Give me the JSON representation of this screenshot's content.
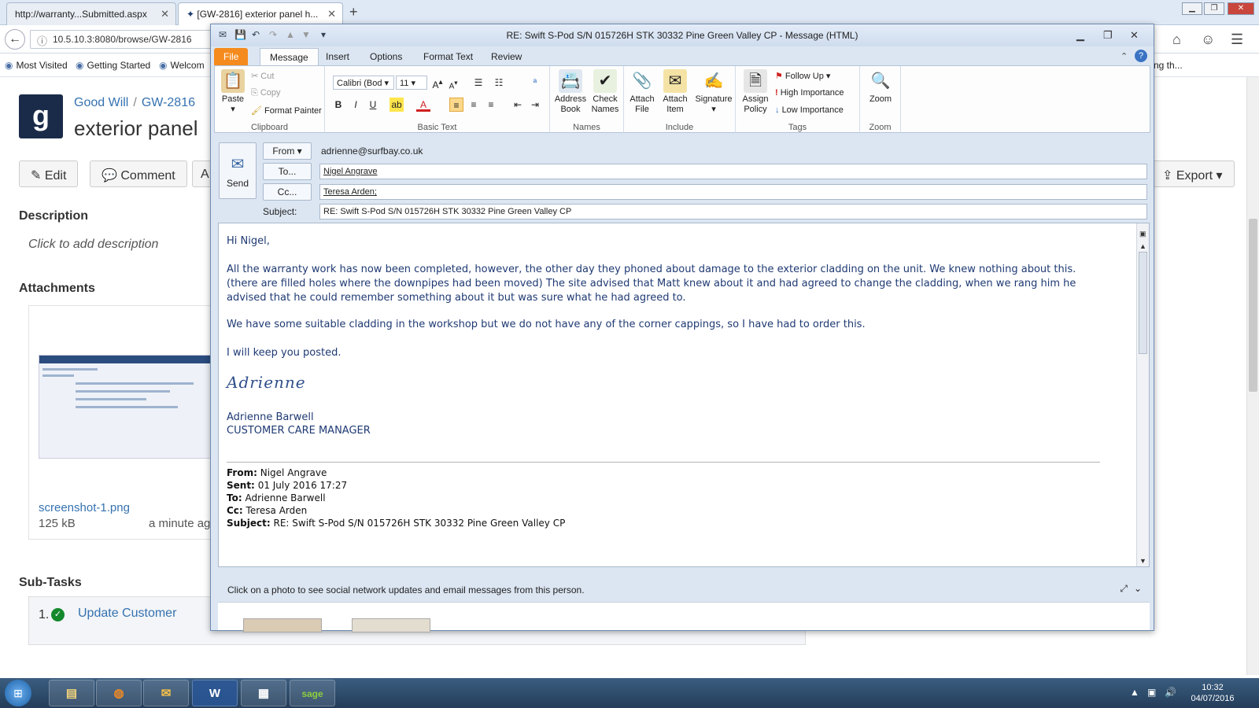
{
  "browser": {
    "tabs": [
      {
        "label": "http://warranty...Submitted.aspx"
      },
      {
        "label": "[GW-2816] exterior panel h..."
      }
    ],
    "url": "10.5.10.3:8080/browse/GW-2816",
    "bookmarks": [
      "Most Visited",
      "Getting Started",
      "Welcom"
    ],
    "bookmark_right_fragment": "ng th..."
  },
  "jira": {
    "logo_text": "g",
    "breadcrumb": {
      "project": "Good Will",
      "issue_key": "GW-2816"
    },
    "title": "exterior panel",
    "buttons": {
      "edit": "Edit",
      "comment": "Comment",
      "more": "A",
      "export": "Export"
    },
    "description": {
      "heading": "Description",
      "placeholder": "Click to add description"
    },
    "attachments": {
      "heading": "Attachments",
      "file_name": "screenshot-1.png",
      "file_size": "125 kB",
      "time": "a minute ag"
    },
    "subtasks": {
      "heading": "Sub-Tasks",
      "number": "1.",
      "item": "Update Customer"
    }
  },
  "outlook": {
    "title": "RE: Swift S-Pod S/N 015726H STK 30332 Pine Green Valley CP  -  Message (HTML)",
    "tabs": [
      "File",
      "Message",
      "Insert",
      "Options",
      "Format Text",
      "Review"
    ],
    "ribbon": {
      "clipboard": {
        "label": "Clipboard",
        "paste": "Paste",
        "cut": "Cut",
        "copy": "Copy",
        "format_painter": "Format Painter"
      },
      "basic_text": {
        "label": "Basic Text",
        "font": "Calibri (Bod",
        "size": "11"
      },
      "names": {
        "label": "Names",
        "address_book": "Address Book",
        "check_names": "Check Names"
      },
      "include": {
        "label": "Include",
        "attach_file": "Attach File",
        "attach_item": "Attach Item",
        "signature": "Signature"
      },
      "tags": {
        "label": "Tags",
        "assign_policy": "Assign Policy",
        "follow_up": "Follow Up",
        "high": "High Importance",
        "low": "Low Importance"
      },
      "zoom": {
        "label": "Zoom",
        "zoom": "Zoom"
      }
    },
    "fields": {
      "send": "Send",
      "from_btn": "From",
      "from_value": "adrienne@surfbay.co.uk",
      "to_btn": "To...",
      "to_value": "Nigel Angrave",
      "cc_btn": "Cc...",
      "cc_value": "Teresa Arden;",
      "subject_label": "Subject:",
      "subject_value": "RE: Swift S-Pod S/N 015726H STK 30332 Pine Green Valley CP"
    },
    "body": {
      "greeting": "Hi Nigel,",
      "para1": "All the warranty work has now been completed, however, the other day they phoned about damage to the exterior cladding on the unit.  We knew nothing about this. (there are filled holes where the downpipes had been moved) The site advised that Matt knew about it and had agreed to change the cladding, when we rang him he advised that he could remember something about it but was sure what he had agreed to.",
      "para2": "We have some suitable cladding in the workshop but we do not have any of the corner cappings, so I have had to order this.",
      "para3": "I will keep you posted.",
      "signature_hand": "Adrienne",
      "sig_name": "Adrienne Barwell",
      "sig_title": "CUSTOMER CARE MANAGER",
      "fwd": {
        "from_label": "From:",
        "from": "Nigel Angrave",
        "sent_label": "Sent:",
        "sent": "01 July 2016 17:27",
        "to_label": "To:",
        "to": "Adrienne Barwell",
        "cc_label": "Cc:",
        "cc": "Teresa Arden",
        "subject_label": "Subject:",
        "subject": "RE: Swift S-Pod S/N 015726H STK 30332 Pine Green Valley CP"
      }
    },
    "social_text": "Click on a photo to see social network updates and email messages from this person."
  },
  "taskbar": {
    "apps": [
      "Explorer",
      "Firefox",
      "Outlook",
      "W",
      "Calculator",
      "sage"
    ],
    "clock": {
      "time": "10:32",
      "date": "04/07/2016"
    }
  },
  "colors": {
    "accent": "#3572b0",
    "file_tab": "#f58b1e",
    "body_text": "#1f3a73"
  }
}
